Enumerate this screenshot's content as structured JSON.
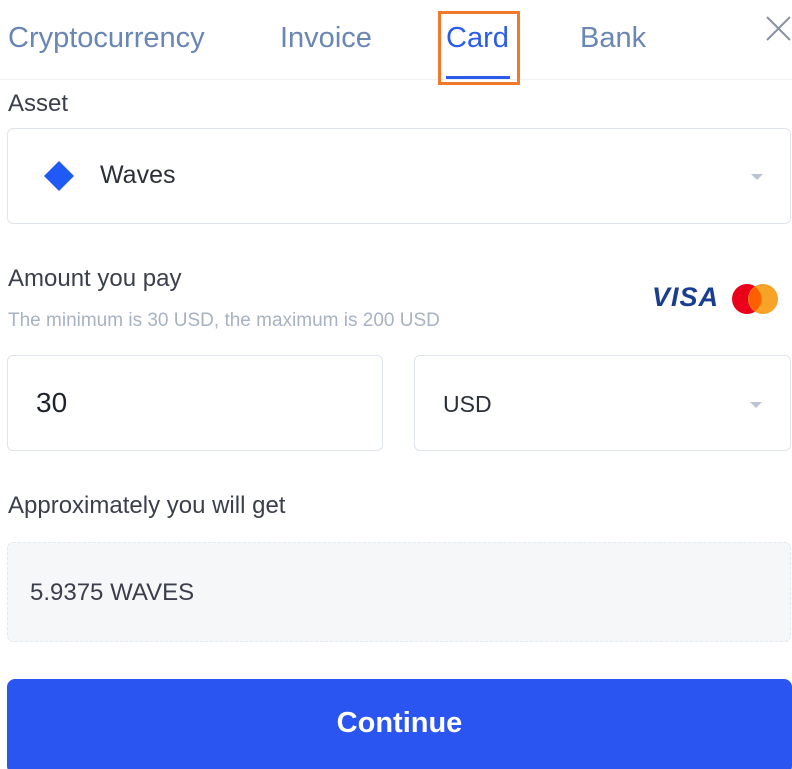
{
  "tabs": [
    {
      "label": "Cryptocurrency",
      "active": false
    },
    {
      "label": "Invoice",
      "active": false
    },
    {
      "label": "Card",
      "active": true
    },
    {
      "label": "Bank",
      "active": false
    }
  ],
  "asset": {
    "label": "Asset",
    "value": "Waves",
    "icon": "waves-diamond-icon"
  },
  "amount": {
    "label": "Amount you pay",
    "hint": "The minimum is 30 USD, the maximum is 200 USD",
    "value": "30",
    "currency": "USD"
  },
  "payment_methods": {
    "visa": "VISA",
    "mastercard_icon": "mastercard-icon"
  },
  "result": {
    "label": "Approximately you will get",
    "value": "5.9375 WAVES"
  },
  "continue_label": "Continue",
  "colors": {
    "accent": "#2a55f0",
    "tab_active": "#2a5bea",
    "tab_inactive": "#6a86b4",
    "highlight": "#f07a2a",
    "waves": "#1f5af6",
    "mastercard_red": "#eb001b",
    "mastercard_orange": "#f79e1b"
  }
}
